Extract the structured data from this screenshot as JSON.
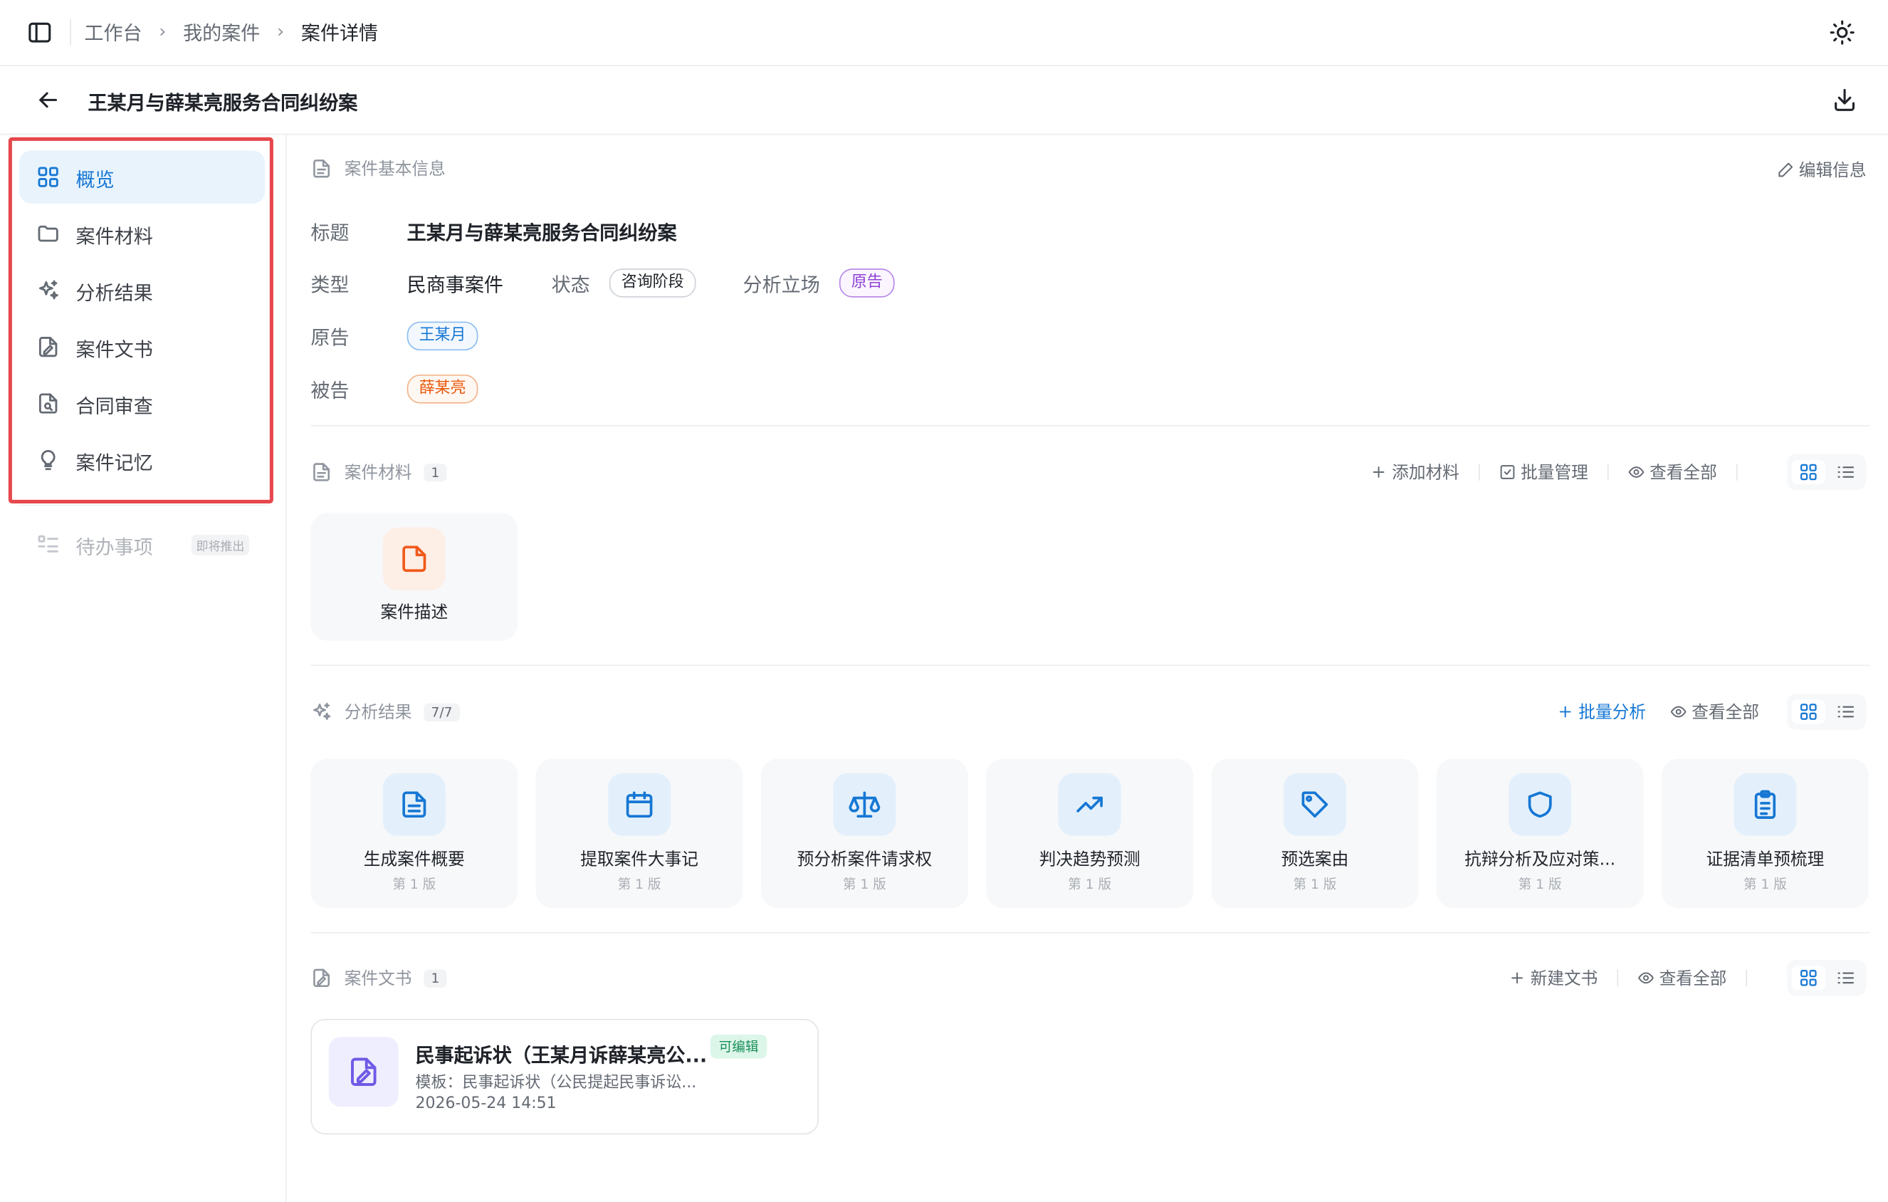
{
  "breadcrumb": [
    "工作台",
    "我的案件",
    "案件详情"
  ],
  "case_title": "王某月与薛某亮服务合同纠纷案",
  "sidebar": {
    "items": [
      {
        "label": "概览",
        "icon": "grid-icon"
      },
      {
        "label": "案件材料",
        "icon": "folder-icon"
      },
      {
        "label": "分析结果",
        "icon": "sparkles-icon"
      },
      {
        "label": "案件文书",
        "icon": "file-signature-icon"
      },
      {
        "label": "合同审查",
        "icon": "file-search-icon"
      },
      {
        "label": "案件记忆",
        "icon": "lightbulb-icon"
      }
    ],
    "todo": {
      "label": "待办事项",
      "badge": "即将推出",
      "icon": "list-todo-icon"
    }
  },
  "basic_info": {
    "heading": "案件基本信息",
    "edit_label": "编辑信息",
    "title_label": "标题",
    "title_value": "王某月与薛某亮服务合同纠纷案",
    "type_label": "类型",
    "type_value": "民商事案件",
    "status_label": "状态",
    "status_value": "咨询阶段",
    "stance_label": "分析立场",
    "stance_value": "原告",
    "plaintiff_label": "原告",
    "plaintiff_value": "王某月",
    "defendant_label": "被告",
    "defendant_value": "薛某亮"
  },
  "materials": {
    "heading": "案件材料",
    "count": "1",
    "actions": {
      "add": "添加材料",
      "batch": "批量管理",
      "view_all": "查看全部"
    },
    "items": [
      {
        "name": "案件描述"
      }
    ]
  },
  "analysis": {
    "heading": "分析结果",
    "count": "7/7",
    "actions": {
      "batch": "批量分析",
      "view_all": "查看全部"
    },
    "items": [
      {
        "name": "生成案件概要",
        "version": "第 1 版",
        "icon": "file-text-icon"
      },
      {
        "name": "提取案件大事记",
        "version": "第 1 版",
        "icon": "calendar-icon"
      },
      {
        "name": "预分析案件请求权",
        "version": "第 1 版",
        "icon": "scale-icon"
      },
      {
        "name": "判决趋势预测",
        "version": "第 1 版",
        "icon": "trending-up-icon"
      },
      {
        "name": "预选案由",
        "version": "第 1 版",
        "icon": "tag-icon"
      },
      {
        "name": "抗辩分析及应对策...",
        "version": "第 1 版",
        "icon": "shield-icon"
      },
      {
        "name": "证据清单预梳理",
        "version": "第 1 版",
        "icon": "clipboard-list-icon"
      }
    ]
  },
  "documents": {
    "heading": "案件文书",
    "count": "1",
    "actions": {
      "new": "新建文书",
      "view_all": "查看全部"
    },
    "items": [
      {
        "title": "民事起诉状（王某月诉薛某亮公...",
        "badge": "可编辑",
        "template": "模板：民事起诉状（公民提起民事诉讼...",
        "date": "2026-05-24 14:51"
      }
    ]
  },
  "colors": {
    "accent": "#1677d4",
    "highlight_border": "#e5484d",
    "active_bg": "#e8f3fc",
    "purple": "#8e3fd6",
    "orange": "#e8590c"
  }
}
